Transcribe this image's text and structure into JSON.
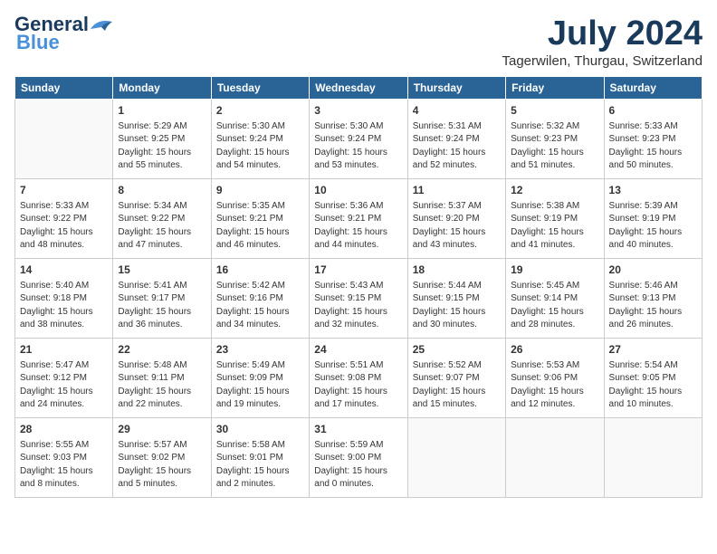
{
  "header": {
    "logo_general": "General",
    "logo_blue": "Blue",
    "month": "July 2024",
    "location": "Tagerwilen, Thurgau, Switzerland"
  },
  "days_of_week": [
    "Sunday",
    "Monday",
    "Tuesday",
    "Wednesday",
    "Thursday",
    "Friday",
    "Saturday"
  ],
  "weeks": [
    [
      {
        "num": "",
        "info": ""
      },
      {
        "num": "1",
        "info": "Sunrise: 5:29 AM\nSunset: 9:25 PM\nDaylight: 15 hours\nand 55 minutes."
      },
      {
        "num": "2",
        "info": "Sunrise: 5:30 AM\nSunset: 9:24 PM\nDaylight: 15 hours\nand 54 minutes."
      },
      {
        "num": "3",
        "info": "Sunrise: 5:30 AM\nSunset: 9:24 PM\nDaylight: 15 hours\nand 53 minutes."
      },
      {
        "num": "4",
        "info": "Sunrise: 5:31 AM\nSunset: 9:24 PM\nDaylight: 15 hours\nand 52 minutes."
      },
      {
        "num": "5",
        "info": "Sunrise: 5:32 AM\nSunset: 9:23 PM\nDaylight: 15 hours\nand 51 minutes."
      },
      {
        "num": "6",
        "info": "Sunrise: 5:33 AM\nSunset: 9:23 PM\nDaylight: 15 hours\nand 50 minutes."
      }
    ],
    [
      {
        "num": "7",
        "info": "Sunrise: 5:33 AM\nSunset: 9:22 PM\nDaylight: 15 hours\nand 48 minutes."
      },
      {
        "num": "8",
        "info": "Sunrise: 5:34 AM\nSunset: 9:22 PM\nDaylight: 15 hours\nand 47 minutes."
      },
      {
        "num": "9",
        "info": "Sunrise: 5:35 AM\nSunset: 9:21 PM\nDaylight: 15 hours\nand 46 minutes."
      },
      {
        "num": "10",
        "info": "Sunrise: 5:36 AM\nSunset: 9:21 PM\nDaylight: 15 hours\nand 44 minutes."
      },
      {
        "num": "11",
        "info": "Sunrise: 5:37 AM\nSunset: 9:20 PM\nDaylight: 15 hours\nand 43 minutes."
      },
      {
        "num": "12",
        "info": "Sunrise: 5:38 AM\nSunset: 9:19 PM\nDaylight: 15 hours\nand 41 minutes."
      },
      {
        "num": "13",
        "info": "Sunrise: 5:39 AM\nSunset: 9:19 PM\nDaylight: 15 hours\nand 40 minutes."
      }
    ],
    [
      {
        "num": "14",
        "info": "Sunrise: 5:40 AM\nSunset: 9:18 PM\nDaylight: 15 hours\nand 38 minutes."
      },
      {
        "num": "15",
        "info": "Sunrise: 5:41 AM\nSunset: 9:17 PM\nDaylight: 15 hours\nand 36 minutes."
      },
      {
        "num": "16",
        "info": "Sunrise: 5:42 AM\nSunset: 9:16 PM\nDaylight: 15 hours\nand 34 minutes."
      },
      {
        "num": "17",
        "info": "Sunrise: 5:43 AM\nSunset: 9:15 PM\nDaylight: 15 hours\nand 32 minutes."
      },
      {
        "num": "18",
        "info": "Sunrise: 5:44 AM\nSunset: 9:15 PM\nDaylight: 15 hours\nand 30 minutes."
      },
      {
        "num": "19",
        "info": "Sunrise: 5:45 AM\nSunset: 9:14 PM\nDaylight: 15 hours\nand 28 minutes."
      },
      {
        "num": "20",
        "info": "Sunrise: 5:46 AM\nSunset: 9:13 PM\nDaylight: 15 hours\nand 26 minutes."
      }
    ],
    [
      {
        "num": "21",
        "info": "Sunrise: 5:47 AM\nSunset: 9:12 PM\nDaylight: 15 hours\nand 24 minutes."
      },
      {
        "num": "22",
        "info": "Sunrise: 5:48 AM\nSunset: 9:11 PM\nDaylight: 15 hours\nand 22 minutes."
      },
      {
        "num": "23",
        "info": "Sunrise: 5:49 AM\nSunset: 9:09 PM\nDaylight: 15 hours\nand 19 minutes."
      },
      {
        "num": "24",
        "info": "Sunrise: 5:51 AM\nSunset: 9:08 PM\nDaylight: 15 hours\nand 17 minutes."
      },
      {
        "num": "25",
        "info": "Sunrise: 5:52 AM\nSunset: 9:07 PM\nDaylight: 15 hours\nand 15 minutes."
      },
      {
        "num": "26",
        "info": "Sunrise: 5:53 AM\nSunset: 9:06 PM\nDaylight: 15 hours\nand 12 minutes."
      },
      {
        "num": "27",
        "info": "Sunrise: 5:54 AM\nSunset: 9:05 PM\nDaylight: 15 hours\nand 10 minutes."
      }
    ],
    [
      {
        "num": "28",
        "info": "Sunrise: 5:55 AM\nSunset: 9:03 PM\nDaylight: 15 hours\nand 8 minutes."
      },
      {
        "num": "29",
        "info": "Sunrise: 5:57 AM\nSunset: 9:02 PM\nDaylight: 15 hours\nand 5 minutes."
      },
      {
        "num": "30",
        "info": "Sunrise: 5:58 AM\nSunset: 9:01 PM\nDaylight: 15 hours\nand 2 minutes."
      },
      {
        "num": "31",
        "info": "Sunrise: 5:59 AM\nSunset: 9:00 PM\nDaylight: 15 hours\nand 0 minutes."
      },
      {
        "num": "",
        "info": ""
      },
      {
        "num": "",
        "info": ""
      },
      {
        "num": "",
        "info": ""
      }
    ]
  ]
}
